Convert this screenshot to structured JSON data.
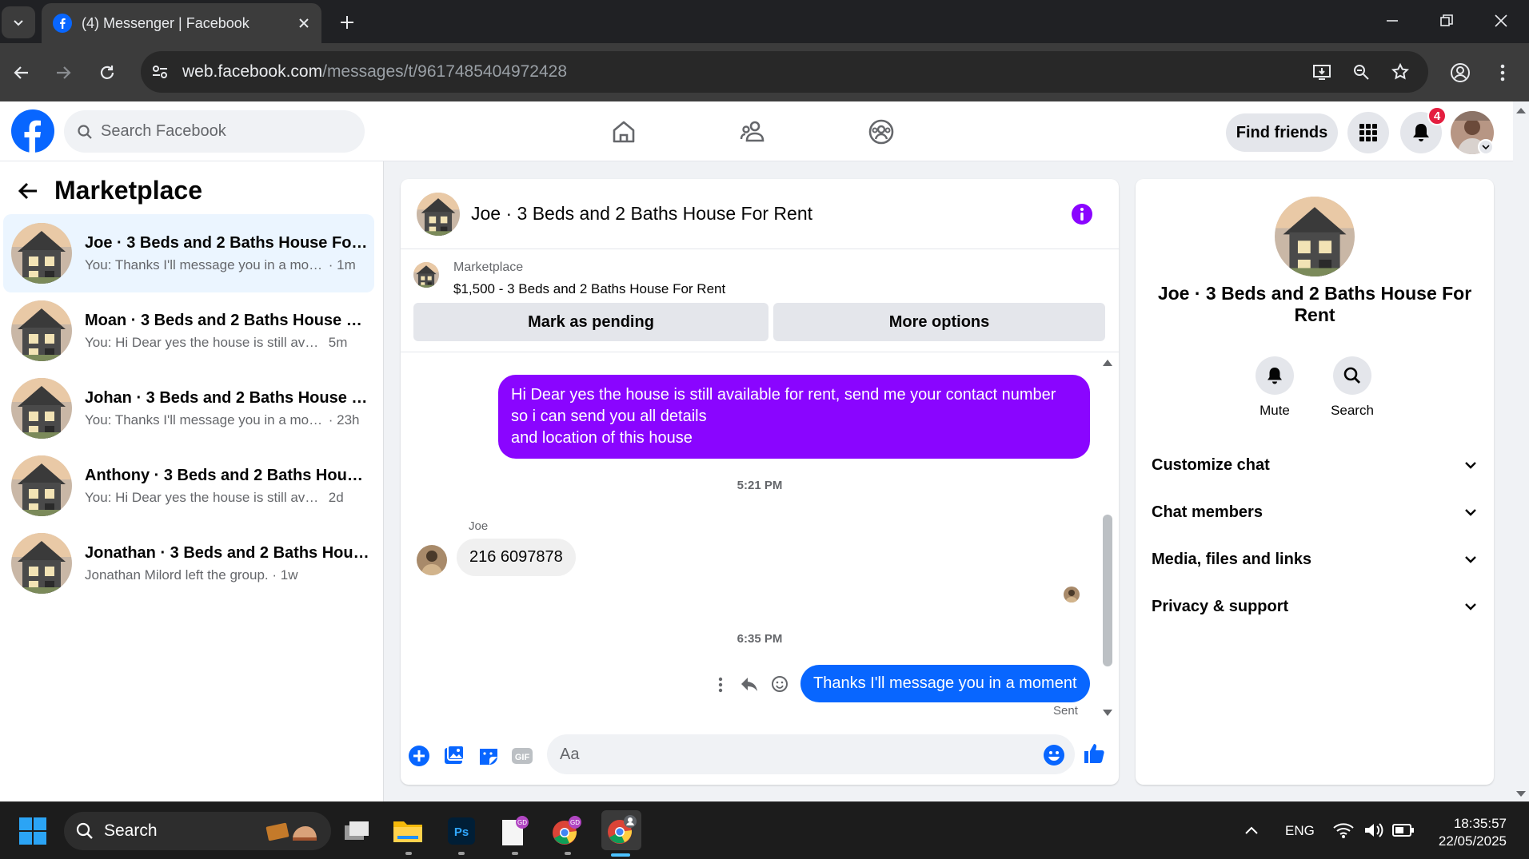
{
  "browser": {
    "tab_title": "(4) Messenger | Facebook",
    "url_host": "web.facebook.com",
    "url_path": "/messages/t/9617485404972428"
  },
  "header": {
    "search_placeholder": "Search Facebook",
    "find_friends": "Find friends",
    "notification_count": "4"
  },
  "sidebar": {
    "title": "Marketplace",
    "conversations": [
      {
        "name": "Joe · 3 Beds and 2 Baths House For Rent",
        "preview": "You: Thanks I'll message you in a moment",
        "time": "· 1m"
      },
      {
        "name": "Moan · 3 Beds and 2 Baths House For Rent",
        "preview": "You: Hi Dear yes the house is still available",
        "time": "5m"
      },
      {
        "name": "Johan · 3 Beds and 2 Baths House For Rent",
        "preview": "You: Thanks I'll message you in a moment",
        "time": "· 23h"
      },
      {
        "name": "Anthony · 3 Beds and 2 Baths House For Rent",
        "preview": "You: Hi Dear yes the house is still available",
        "time": "2d"
      },
      {
        "name": "Jonathan · 3 Beds and 2 Baths House For Rent",
        "preview": "Jonathan Milord left the group.",
        "time": "· 1w"
      }
    ]
  },
  "chat": {
    "title": "Joe · 3 Beds and 2 Baths House For Rent",
    "listing_source": "Marketplace",
    "listing_title": "$1,500 - 3 Beds and 2 Baths House For Rent",
    "mark_pending": "Mark as pending",
    "more_options": "More options",
    "messages": {
      "out1_line1": "Hi Dear yes the house is still available for rent, send me your contact number",
      "out1_line2": "so i can send you all details",
      "out1_line3": "and location of this house",
      "time1": "5:21 PM",
      "sender": "Joe",
      "in1": "216 6097878",
      "time2": "6:35 PM",
      "out2": "Thanks I'll message you in a moment",
      "status": "Sent"
    },
    "composer_placeholder": "Aa"
  },
  "info": {
    "name": "Joe · 3 Beds and 2 Baths House For Rent",
    "mute": "Mute",
    "search": "Search",
    "sections": [
      "Customize chat",
      "Chat members",
      "Media, files and links",
      "Privacy & support"
    ]
  },
  "taskbar": {
    "search": "Search",
    "language": "ENG",
    "time": "18:35:57",
    "date": "22/05/2025"
  },
  "colors": {
    "facebook_blue": "#0866ff",
    "message_purple": "#8a05ff",
    "active_conversation": "#ebf5ff"
  }
}
